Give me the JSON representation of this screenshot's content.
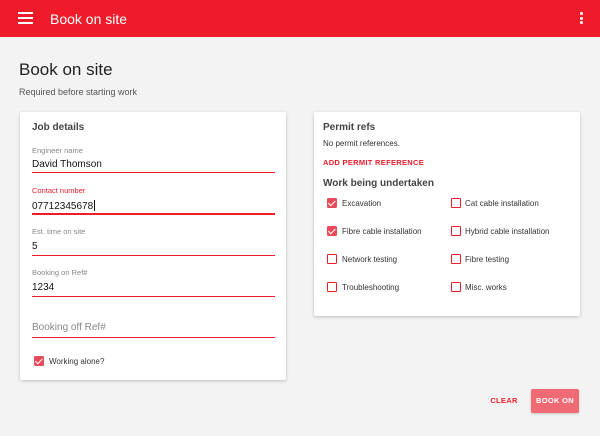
{
  "app_bar": {
    "title": "Book on site",
    "menu_icon": "hamburger-menu-icon",
    "more_icon": "more-vertical-icon",
    "color": "#ee1c2b"
  },
  "page": {
    "title": "Book on site",
    "subtitle": "Required before starting work"
  },
  "job_details": {
    "heading": "Job details",
    "engineer_name": {
      "label": "Engineer name",
      "value": "David Thomson"
    },
    "contact_number": {
      "label": "Contact number",
      "value": "07712345678"
    },
    "est_time": {
      "label": "Est. time on site",
      "value": "5"
    },
    "booking_on_ref": {
      "label": "Booking on Ref#",
      "value": "1234"
    },
    "booking_off_ref": {
      "placeholder": "Booking off Ref#"
    },
    "working_alone": {
      "label": "Working alone?",
      "checked": true
    }
  },
  "permit_refs": {
    "heading": "Permit refs",
    "empty_text": "No permit references.",
    "add_label": "ADD PERMIT REFERENCE"
  },
  "work": {
    "heading": "Work being undertaken",
    "items": [
      {
        "label": "Excavation",
        "checked": true
      },
      {
        "label": "Cat cable installation",
        "checked": false
      },
      {
        "label": "Fibre cable installation",
        "checked": true
      },
      {
        "label": "Hybrid cable installation",
        "checked": false
      },
      {
        "label": "Network testing",
        "checked": false
      },
      {
        "label": "Fibre testing",
        "checked": false
      },
      {
        "label": "Troubleshooting",
        "checked": false
      },
      {
        "label": "Misc. works",
        "checked": false
      }
    ]
  },
  "actions": {
    "clear_label": "CLEAR",
    "book_on_label": "BOOK ON"
  }
}
